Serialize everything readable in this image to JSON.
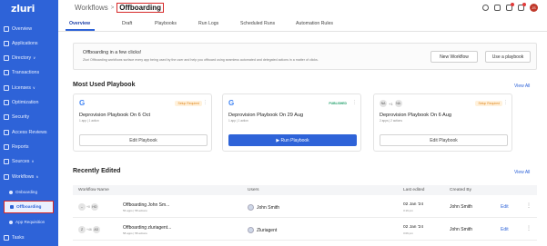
{
  "app": {
    "logo": "zluri"
  },
  "sidebar": {
    "items": [
      {
        "label": "Overview",
        "icon": "grid-icon"
      },
      {
        "label": "Applications",
        "icon": "apps-icon"
      },
      {
        "label": "Directory",
        "icon": "users-icon",
        "chevron": "∨"
      },
      {
        "label": "Transactions",
        "icon": "transactions-icon"
      },
      {
        "label": "Licenses",
        "icon": "license-icon",
        "chevron": "∨"
      },
      {
        "label": "Optimization",
        "icon": "optimization-icon"
      },
      {
        "label": "Security",
        "icon": "shield-icon"
      },
      {
        "label": "Access Reviews",
        "icon": "access-review-icon"
      },
      {
        "label": "Reports",
        "icon": "reports-icon"
      },
      {
        "label": "Sources",
        "icon": "sources-icon",
        "chevron": "∨"
      },
      {
        "label": "Workflows",
        "icon": "workflow-icon",
        "chevron": "∧"
      },
      {
        "label": "Onboarding",
        "icon": "onboarding-icon"
      },
      {
        "label": "Offboarding",
        "icon": "offboarding-icon"
      },
      {
        "label": "App Requisition",
        "icon": "requisition-icon"
      },
      {
        "label": "Tasks",
        "icon": "tasks-icon"
      }
    ]
  },
  "header": {
    "breadcrumb_root": "Workflows",
    "breadcrumb_sep": ">",
    "breadcrumb_current": "Offboarding",
    "avatar_initials": "JS"
  },
  "tabs": [
    "Overview",
    "Draft",
    "Playbooks",
    "Run Logs",
    "Scheduled Runs",
    "Automation Rules"
  ],
  "banner": {
    "title": "Offboarding in a few clicks!",
    "description": "Zluri Offboarding workflows surface every app being used by the user and help you offboard using seamless automated and delegated actions in a matter of clicks.",
    "new_workflow": "New Workflow",
    "use_playbook": "Use a playbook"
  },
  "most_used": {
    "title": "Most Used Playbook",
    "view_all": "View All",
    "cards": [
      {
        "logo": "G",
        "status": "Setup Required",
        "name": "Deprovision Playbook On 6 Oct",
        "meta": "1 app | 1 action",
        "button": "Edit Playbook"
      },
      {
        "logo": "G",
        "status": "PUBLISHED",
        "name": "Deprovision Playbook On 29 Aug",
        "meta": "1 app | 1 action",
        "button": "▶ Run Playbook"
      },
      {
        "avatars": [
          "NA",
          "+1",
          "NA"
        ],
        "status": "Setup Required",
        "name": "Deprovision Playbook On 6 Aug",
        "meta": "2 apps | 2 actions",
        "button": "Edit Playbook"
      }
    ]
  },
  "recent": {
    "title": "Recently Edited",
    "view_all": "View All",
    "columns": [
      "Workflow Name",
      "Users",
      "Last edited",
      "Created By"
    ],
    "rows": [
      {
        "avatars": [
          "–",
          "+0",
          "HO"
        ],
        "name": "Offboarding John Sm...",
        "sub": "56 apps | 58 actions",
        "user": "John Smith",
        "date": "02 Jan '24",
        "time": "3:16 pm",
        "created_by": "John Smith",
        "edit": "Edit"
      },
      {
        "avatars": [
          "Z",
          "+46",
          "AD"
        ],
        "name": "Offboarding zluriagent...",
        "sub": "58 apps | 58 actions",
        "user": "Zluriagent",
        "date": "02 Jan '24",
        "time": "3:06 pm",
        "created_by": "John Smith",
        "edit": "Edit"
      }
    ]
  },
  "colors": {
    "sidebar": "#2e63d8",
    "accent": "#2e63d8",
    "highlight_border": "#d62828",
    "published": "#22a06b",
    "setup": "#e0861a"
  }
}
